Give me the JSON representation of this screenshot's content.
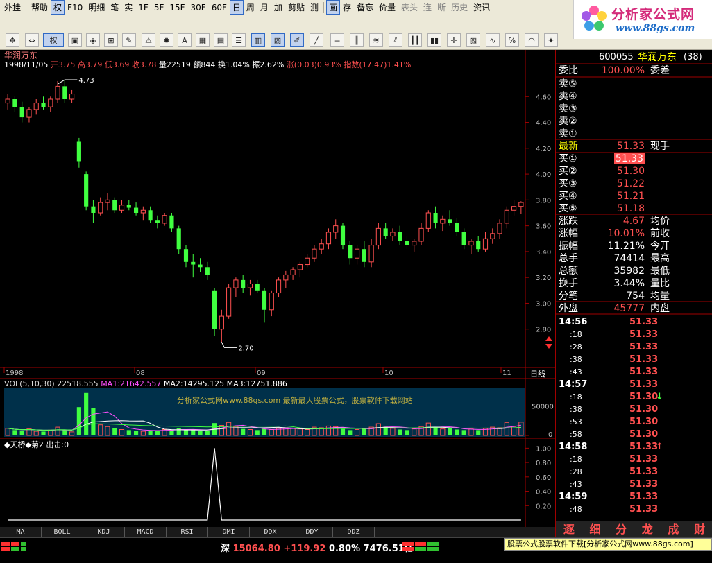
{
  "menu": {
    "items": [
      "外挂",
      "帮助",
      "权",
      "F10",
      "明细",
      "笔",
      "实",
      "1F",
      "5F",
      "15F",
      "30F",
      "60F",
      "日",
      "周",
      "月",
      "加",
      "剪贴",
      "测",
      "画",
      "存",
      "备忘",
      "价量",
      "表头",
      "连",
      "断",
      "历史",
      "资讯"
    ]
  },
  "toolbar": {
    "quan_label": "权"
  },
  "logo": {
    "text": "分析家公式网",
    "url": "www.88gs.com"
  },
  "chart": {
    "stock_name": "华润万东",
    "info_line": {
      "date": "1998/11/05",
      "open": "开3.75",
      "high": "高3.79",
      "low": "低3.69",
      "close": "收3.78",
      "volume": "量22519",
      "amount": "额844",
      "turnover": "换1.04%",
      "amplitude": "振2.62%",
      "change": "涨(0.03)0.93%",
      "index": "指数(17.47)1.41%"
    },
    "annotation_high": "4.73",
    "annotation_low": "2.70",
    "date_labels": [
      "1998",
      "08",
      "09",
      "10",
      "11"
    ],
    "period_label": "日线",
    "vol_line": {
      "title": "VOL(5,10,30)",
      "value": "22518.555",
      "ma1": "MA1:21642.557",
      "ma2": "MA2:14295.125",
      "ma3": "MA3:12751.886"
    },
    "watermark": "分析家公式网www.88gs.com 最新最大股票公式，股票软件下载网站",
    "vol_axis": [
      "50000",
      "0"
    ],
    "indicator": {
      "title": "◆天桥◆菊2 出击:0"
    }
  },
  "chart_data": [
    {
      "type": "candlestick",
      "title": "华润万东",
      "ylim": [
        2.6,
        4.8
      ],
      "yticks": [
        4.6,
        4.4,
        4.2,
        4.0,
        3.8,
        3.6,
        3.4,
        3.2,
        3.0,
        2.8
      ],
      "ytick_labels": [
        "4.60",
        "4.40",
        "4.20",
        "4.00",
        "3.80",
        "3.60",
        "3.40",
        "3.20",
        "3.00",
        "2.80"
      ],
      "xtick_labels": [
        "1998",
        "08",
        "09",
        "10",
        "11"
      ],
      "candles": [
        [
          4.55,
          4.62,
          4.5,
          4.58
        ],
        [
          4.58,
          4.6,
          4.48,
          4.52
        ],
        [
          4.52,
          4.56,
          4.4,
          4.44
        ],
        [
          4.44,
          4.52,
          4.4,
          4.5
        ],
        [
          4.5,
          4.58,
          4.46,
          4.55
        ],
        [
          4.55,
          4.6,
          4.5,
          4.52
        ],
        [
          4.52,
          4.6,
          4.48,
          4.58
        ],
        [
          4.58,
          4.72,
          4.55,
          4.68
        ],
        [
          4.68,
          4.73,
          4.55,
          4.58
        ],
        [
          4.58,
          4.65,
          4.55,
          4.62
        ],
        [
          4.25,
          4.28,
          4.05,
          4.1
        ],
        [
          4.0,
          4.02,
          3.72,
          3.75
        ],
        [
          3.75,
          3.8,
          3.62,
          3.7
        ],
        [
          3.7,
          3.82,
          3.68,
          3.78
        ],
        [
          3.78,
          3.85,
          3.72,
          3.8
        ],
        [
          3.8,
          3.82,
          3.7,
          3.72
        ],
        [
          3.72,
          3.8,
          3.7,
          3.76
        ],
        [
          3.76,
          3.8,
          3.72,
          3.74
        ],
        [
          3.74,
          3.78,
          3.68,
          3.7
        ],
        [
          3.7,
          3.75,
          3.64,
          3.72
        ],
        [
          3.72,
          3.75,
          3.62,
          3.64
        ],
        [
          3.64,
          3.68,
          3.58,
          3.62
        ],
        [
          3.62,
          3.7,
          3.6,
          3.68
        ],
        [
          3.68,
          3.7,
          3.55,
          3.58
        ],
        [
          3.58,
          3.6,
          3.38,
          3.42
        ],
        [
          3.42,
          3.45,
          3.28,
          3.32
        ],
        [
          3.32,
          3.38,
          3.2,
          3.3
        ],
        [
          3.3,
          3.35,
          3.24,
          3.28
        ],
        [
          3.28,
          3.32,
          3.18,
          3.22
        ],
        [
          3.1,
          3.12,
          2.75,
          2.8
        ],
        [
          2.8,
          2.95,
          2.7,
          2.9
        ],
        [
          2.9,
          3.15,
          2.88,
          3.12
        ],
        [
          3.12,
          3.2,
          3.05,
          3.18
        ],
        [
          3.18,
          3.22,
          3.08,
          3.12
        ],
        [
          3.12,
          3.18,
          3.06,
          3.15
        ],
        [
          3.15,
          3.18,
          3.08,
          3.1
        ],
        [
          3.1,
          3.12,
          2.85,
          2.95
        ],
        [
          2.95,
          3.1,
          2.9,
          3.08
        ],
        [
          3.08,
          3.2,
          3.05,
          3.18
        ],
        [
          3.18,
          3.25,
          3.12,
          3.22
        ],
        [
          3.22,
          3.28,
          3.18,
          3.26
        ],
        [
          3.26,
          3.32,
          3.2,
          3.3
        ],
        [
          3.3,
          3.38,
          3.28,
          3.35
        ],
        [
          3.35,
          3.45,
          3.32,
          3.42
        ],
        [
          3.42,
          3.5,
          3.38,
          3.46
        ],
        [
          3.46,
          3.58,
          3.42,
          3.55
        ],
        [
          3.55,
          3.65,
          3.5,
          3.6
        ],
        [
          3.6,
          3.62,
          3.42,
          3.45
        ],
        [
          3.45,
          3.48,
          3.3,
          3.35
        ],
        [
          3.35,
          3.45,
          3.3,
          3.42
        ],
        [
          3.42,
          3.48,
          3.28,
          3.32
        ],
        [
          3.32,
          3.5,
          3.28,
          3.45
        ],
        [
          3.45,
          3.62,
          3.42,
          3.58
        ],
        [
          3.58,
          3.62,
          3.5,
          3.52
        ],
        [
          3.52,
          3.58,
          3.48,
          3.55
        ],
        [
          3.55,
          3.6,
          3.45,
          3.48
        ],
        [
          3.48,
          3.52,
          3.42,
          3.45
        ],
        [
          3.45,
          3.5,
          3.4,
          3.48
        ],
        [
          3.48,
          3.62,
          3.45,
          3.58
        ],
        [
          3.58,
          3.72,
          3.55,
          3.7
        ],
        [
          3.7,
          3.75,
          3.58,
          3.62
        ],
        [
          3.62,
          3.68,
          3.56,
          3.65
        ],
        [
          3.65,
          3.72,
          3.6,
          3.62
        ],
        [
          3.62,
          3.66,
          3.52,
          3.55
        ],
        [
          3.55,
          3.58,
          3.42,
          3.45
        ],
        [
          3.45,
          3.5,
          3.38,
          3.48
        ],
        [
          3.48,
          3.52,
          3.4,
          3.42
        ],
        [
          3.42,
          3.55,
          3.4,
          3.5
        ],
        [
          3.5,
          3.58,
          3.46,
          3.54
        ],
        [
          3.54,
          3.65,
          3.5,
          3.62
        ],
        [
          3.62,
          3.75,
          3.58,
          3.72
        ],
        [
          3.72,
          3.8,
          3.68,
          3.75
        ],
        [
          3.75,
          3.79,
          3.69,
          3.78
        ]
      ]
    },
    {
      "type": "bar",
      "title": "VOL(5,10,30)",
      "ylim": [
        0,
        80000
      ],
      "yticks": [
        50000,
        0
      ],
      "values": [
        12000,
        9000,
        8000,
        11000,
        7000,
        6500,
        9000,
        14000,
        9000,
        6000,
        48000,
        72000,
        46000,
        18000,
        15000,
        12000,
        10000,
        9000,
        8000,
        7000,
        9000,
        8500,
        10000,
        9500,
        12000,
        10000,
        9000,
        8000,
        7500,
        21000,
        17000,
        22000,
        15000,
        11000,
        10000,
        9000,
        11000,
        10000,
        12000,
        13000,
        12000,
        11000,
        10000,
        14000,
        13000,
        16000,
        15000,
        11000,
        9000,
        10000,
        12000,
        14000,
        20000,
        15000,
        12000,
        10000,
        9000,
        11000,
        15000,
        21000,
        14000,
        11000,
        12000,
        10000,
        9000,
        11000,
        9000,
        12000,
        14000,
        13000,
        22000,
        15000,
        22519
      ],
      "ma_lines": [
        {
          "name": "MA1",
          "value": 21642.557
        },
        {
          "name": "MA2",
          "value": 14295.125
        },
        {
          "name": "MA3",
          "value": 12751.886
        }
      ]
    },
    {
      "type": "line",
      "title": "◆天桥◆菊2 出击:0",
      "ylim": [
        0,
        1.1
      ],
      "yticks": [
        1.0,
        0.8,
        0.6,
        0.4,
        0.2
      ],
      "spike_index": 29,
      "spike_value": 1.0
    }
  ],
  "quote": {
    "code": "600055",
    "name": "华润万东",
    "suffix": "(38)",
    "weibi_label": "委比",
    "weibi_value": "100.00%",
    "weicha_label": "委差",
    "sell": [
      "卖⑤",
      "卖④",
      "卖③",
      "卖②",
      "卖①"
    ],
    "latest_label": "最新",
    "latest_value": "51.33",
    "xianshou_label": "现手",
    "buy": [
      {
        "label": "买①",
        "value": "51.33"
      },
      {
        "label": "买②",
        "value": "51.30"
      },
      {
        "label": "买③",
        "value": "51.22"
      },
      {
        "label": "买④",
        "value": "51.21"
      },
      {
        "label": "买⑤",
        "value": "51.18"
      }
    ],
    "stats": [
      {
        "l": "涨跌",
        "v": "4.67",
        "c": "#ff5050",
        "l2": "均价"
      },
      {
        "l": "涨幅",
        "v": "10.01%",
        "c": "#ff5050",
        "l2": "前收"
      },
      {
        "l": "振幅",
        "v": "11.21%",
        "c": "#ffffff",
        "l2": "今开"
      },
      {
        "l": "总手",
        "v": "74414",
        "c": "#ffffff",
        "l2": "最高"
      },
      {
        "l": "总额",
        "v": "35982",
        "c": "#ffffff",
        "l2": "最低"
      },
      {
        "l": "换手",
        "v": "3.44%",
        "c": "#ffffff",
        "l2": "量比"
      },
      {
        "l": "分笔",
        "v": "754",
        "c": "#ffffff",
        "l2": "均量"
      },
      {
        "l": "外盘",
        "v": "45777",
        "c": "#ff5050",
        "l2": "内盘"
      }
    ]
  },
  "ticks": [
    {
      "t": "14:56",
      "p": "51.33",
      "a": ""
    },
    {
      "t": ":18",
      "p": "51.33",
      "a": ""
    },
    {
      "t": ":28",
      "p": "51.33",
      "a": ""
    },
    {
      "t": ":38",
      "p": "51.33",
      "a": ""
    },
    {
      "t": ":43",
      "p": "51.33",
      "a": ""
    },
    {
      "t": "14:57",
      "p": "51.33",
      "a": ""
    },
    {
      "t": ":18",
      "p": "51.30",
      "a": "↓"
    },
    {
      "t": ":38",
      "p": "51.30",
      "a": ""
    },
    {
      "t": ":53",
      "p": "51.30",
      "a": ""
    },
    {
      "t": ":58",
      "p": "51.30",
      "a": ""
    },
    {
      "t": "14:58",
      "p": "51.33",
      "a": "↑"
    },
    {
      "t": ":18",
      "p": "51.33",
      "a": ""
    },
    {
      "t": ":28",
      "p": "51.33",
      "a": ""
    },
    {
      "t": ":43",
      "p": "51.33",
      "a": ""
    },
    {
      "t": "14:59",
      "p": "51.33",
      "a": ""
    },
    {
      "t": ":48",
      "p": "51.33",
      "a": ""
    }
  ],
  "rp_tabs": [
    "逐",
    "细",
    "分",
    "龙",
    "成",
    "财"
  ],
  "indicator_tabs": [
    "MA",
    "BOLL",
    "KDJ",
    "MACD",
    "RSI",
    "DMI",
    "DDX",
    "DDY",
    "DDZ"
  ],
  "status": {
    "market": "深",
    "index": "15064.80",
    "change": "+119.92",
    "pct": "0.80%",
    "amount": "7476.51亿",
    "hint": "股票公式股票软件下载[分析家公式网www.88gs.com]"
  }
}
